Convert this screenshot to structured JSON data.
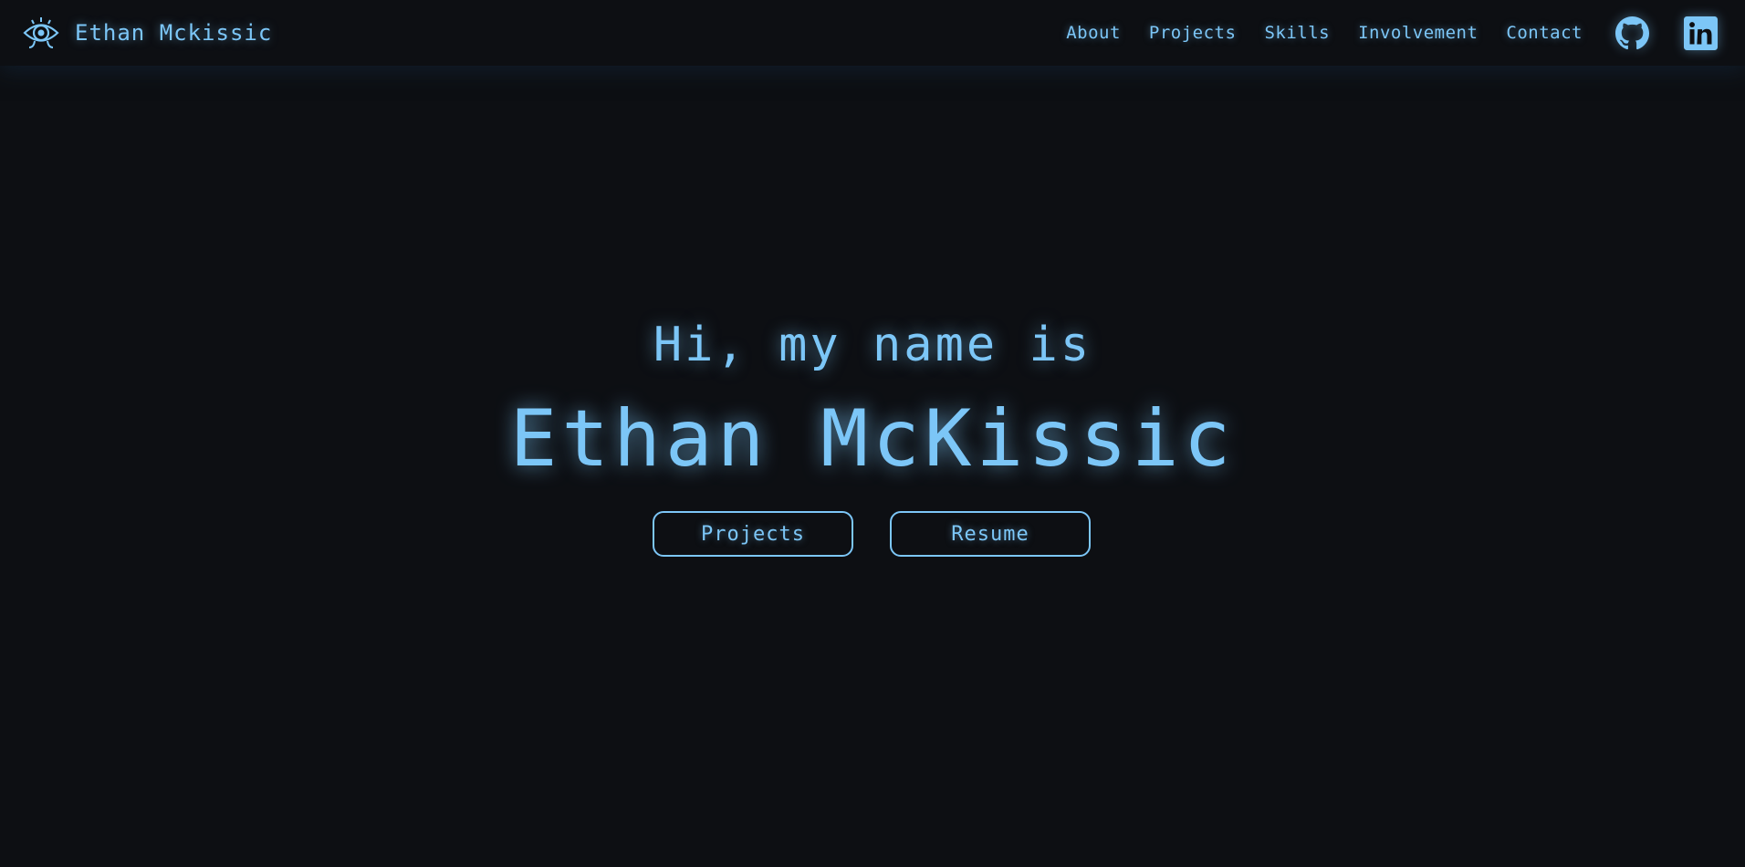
{
  "brand": {
    "name": "Ethan Mckissic",
    "logo_icon": "eye-logo-icon"
  },
  "nav": {
    "links": [
      "About",
      "Projects",
      "Skills",
      "Involvement",
      "Contact"
    ],
    "social": [
      {
        "icon": "github-icon"
      },
      {
        "icon": "linkedin-icon"
      }
    ]
  },
  "hero": {
    "greeting": "Hi, my name is",
    "name": "Ethan McKissic",
    "buttons": [
      "Projects",
      "Resume"
    ]
  },
  "colors": {
    "background": "#0d0f13",
    "accent": "#7cc6f7"
  }
}
